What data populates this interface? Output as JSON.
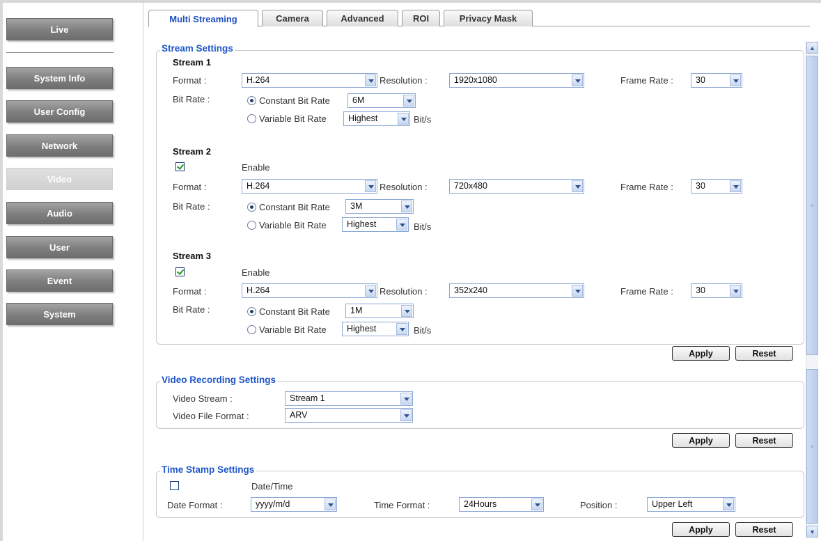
{
  "sidebar": {
    "items": [
      {
        "label": "Live"
      },
      {
        "label": "System Info"
      },
      {
        "label": "User Config"
      },
      {
        "label": "Network"
      },
      {
        "label": "Video"
      },
      {
        "label": "Audio"
      },
      {
        "label": "User"
      },
      {
        "label": "Event"
      },
      {
        "label": "System"
      }
    ],
    "active": "Video"
  },
  "tabs": [
    {
      "label": "Multi Streaming",
      "active": true
    },
    {
      "label": "Camera"
    },
    {
      "label": "Advanced"
    },
    {
      "label": "ROI"
    },
    {
      "label": "Privacy Mask"
    }
  ],
  "labels": {
    "format": "Format :",
    "resolution": "Resolution :",
    "frame_rate": "Frame Rate :",
    "bit_rate": "Bit Rate :",
    "cbr": "Constant Bit Rate",
    "vbr": "Variable Bit Rate",
    "bits": "Bit/s",
    "enable": "Enable",
    "apply": "Apply",
    "reset": "Reset"
  },
  "stream_settings": {
    "title": "Stream Settings",
    "streams": [
      {
        "title": "Stream 1",
        "format": "H.264",
        "resolution": "1920x1080",
        "frame_rate": "30",
        "cbr_value": "6M",
        "vbr_value": "Highest",
        "mode": "constant"
      },
      {
        "title": "Stream 2",
        "enabled": true,
        "format": "H.264",
        "resolution": "720x480",
        "frame_rate": "30",
        "cbr_value": "3M",
        "vbr_value": "Highest",
        "mode": "constant"
      },
      {
        "title": "Stream 3",
        "enabled": true,
        "format": "H.264",
        "resolution": "352x240",
        "frame_rate": "30",
        "cbr_value": "1M",
        "vbr_value": "Highest",
        "mode": "constant"
      }
    ]
  },
  "recording": {
    "title": "Video Recording Settings",
    "video_stream_label": "Video Stream :",
    "video_stream": "Stream 1",
    "file_format_label": "Video File Format :",
    "file_format": "ARV"
  },
  "timestamp": {
    "title": "Time Stamp Settings",
    "datetime_label": "Date/Time",
    "datetime_checked": false,
    "date_format_label": "Date Format :",
    "date_format": "yyyy/m/d",
    "time_format_label": "Time Format :",
    "time_format": "24Hours",
    "position_label": "Position :",
    "position": "Upper Left"
  }
}
